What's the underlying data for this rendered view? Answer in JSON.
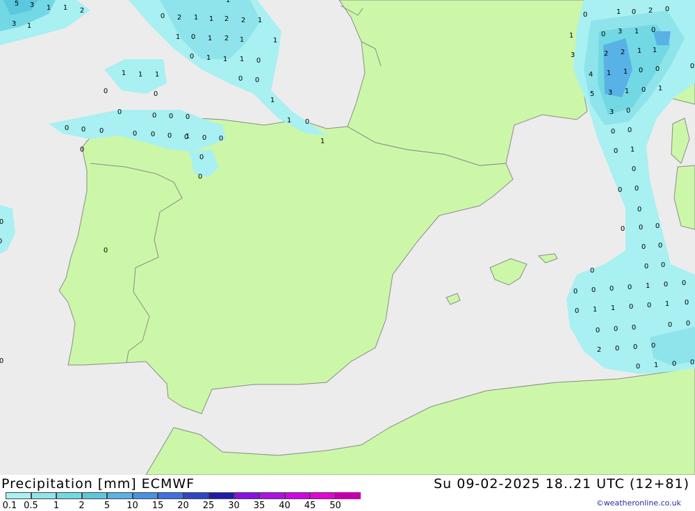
{
  "header": {
    "title": "Precipitation [mm] ECMWF",
    "valid_time": "Su 09-02-2025 18..21 UTC (12+81)"
  },
  "credit": "©weatheronline.co.uk",
  "colors": {
    "sea": "#ececec",
    "land": "#ccf7a8",
    "border": "#8a8a8a"
  },
  "legend": {
    "labels": [
      "0.1",
      "0.5",
      "1",
      "2",
      "5",
      "10",
      "15",
      "20",
      "25",
      "30",
      "35",
      "40",
      "45",
      "50"
    ],
    "colors": [
      "#a8f0f2",
      "#8ee4ea",
      "#72d8e4",
      "#5cc8de",
      "#58b2e6",
      "#4a92e6",
      "#3f6fe0",
      "#2f46c8",
      "#1c1ca8",
      "#8a10e8",
      "#b010e6",
      "#d400e8",
      "#e800d6",
      "#c000a8"
    ]
  },
  "map_values": [
    "5",
    "3",
    "1",
    "1",
    "2",
    "3",
    "1",
    "0",
    "2",
    "1",
    "1",
    "2",
    "2",
    "1",
    "1",
    "1",
    "0",
    "1",
    "2",
    "1",
    "1",
    "0",
    "1",
    "1",
    "1",
    "0",
    "0",
    "0",
    "1",
    "1",
    "1",
    "1",
    "0",
    "0",
    "1",
    "0",
    "1",
    "0",
    "0",
    "0",
    "0",
    "0",
    "0",
    "0",
    "0",
    "0",
    "0",
    "0",
    "1",
    "0",
    "0",
    "0",
    "0",
    "0",
    "0",
    "0",
    "0",
    "0",
    "0",
    "0",
    "1",
    "2",
    "0",
    "0",
    "1",
    "3",
    "1",
    "0",
    "0",
    "3",
    "2",
    "2",
    "1",
    "1",
    "4",
    "1",
    "1",
    "0",
    "0",
    "5",
    "3",
    "1",
    "0",
    "1",
    "3",
    "0",
    "0",
    "0",
    "0",
    "1",
    "0",
    "0",
    "0",
    "0",
    "0",
    "0",
    "0",
    "0",
    "0",
    "0",
    "0",
    "0",
    "0",
    "0",
    "0",
    "0",
    "1",
    "0",
    "0",
    "0",
    "1",
    "1",
    "0",
    "0",
    "1",
    "0",
    "0",
    "0",
    "0",
    "0",
    "0",
    "2",
    "0",
    "0",
    "0",
    "0",
    "1",
    "0",
    "0"
  ]
}
